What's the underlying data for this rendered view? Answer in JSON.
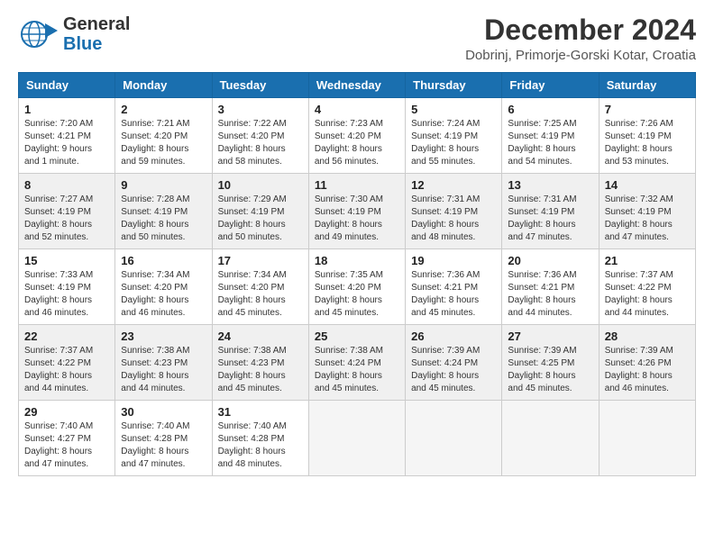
{
  "logo": {
    "line1": "General",
    "line2": "Blue"
  },
  "header": {
    "month": "December 2024",
    "location": "Dobrinj, Primorje-Gorski Kotar, Croatia"
  },
  "weekdays": [
    "Sunday",
    "Monday",
    "Tuesday",
    "Wednesday",
    "Thursday",
    "Friday",
    "Saturday"
  ],
  "weeks": [
    [
      {
        "day": "1",
        "sunrise": "Sunrise: 7:20 AM",
        "sunset": "Sunset: 4:21 PM",
        "daylight": "Daylight: 9 hours and 1 minute."
      },
      {
        "day": "2",
        "sunrise": "Sunrise: 7:21 AM",
        "sunset": "Sunset: 4:20 PM",
        "daylight": "Daylight: 8 hours and 59 minutes."
      },
      {
        "day": "3",
        "sunrise": "Sunrise: 7:22 AM",
        "sunset": "Sunset: 4:20 PM",
        "daylight": "Daylight: 8 hours and 58 minutes."
      },
      {
        "day": "4",
        "sunrise": "Sunrise: 7:23 AM",
        "sunset": "Sunset: 4:20 PM",
        "daylight": "Daylight: 8 hours and 56 minutes."
      },
      {
        "day": "5",
        "sunrise": "Sunrise: 7:24 AM",
        "sunset": "Sunset: 4:19 PM",
        "daylight": "Daylight: 8 hours and 55 minutes."
      },
      {
        "day": "6",
        "sunrise": "Sunrise: 7:25 AM",
        "sunset": "Sunset: 4:19 PM",
        "daylight": "Daylight: 8 hours and 54 minutes."
      },
      {
        "day": "7",
        "sunrise": "Sunrise: 7:26 AM",
        "sunset": "Sunset: 4:19 PM",
        "daylight": "Daylight: 8 hours and 53 minutes."
      }
    ],
    [
      {
        "day": "8",
        "sunrise": "Sunrise: 7:27 AM",
        "sunset": "Sunset: 4:19 PM",
        "daylight": "Daylight: 8 hours and 52 minutes."
      },
      {
        "day": "9",
        "sunrise": "Sunrise: 7:28 AM",
        "sunset": "Sunset: 4:19 PM",
        "daylight": "Daylight: 8 hours and 50 minutes."
      },
      {
        "day": "10",
        "sunrise": "Sunrise: 7:29 AM",
        "sunset": "Sunset: 4:19 PM",
        "daylight": "Daylight: 8 hours and 50 minutes."
      },
      {
        "day": "11",
        "sunrise": "Sunrise: 7:30 AM",
        "sunset": "Sunset: 4:19 PM",
        "daylight": "Daylight: 8 hours and 49 minutes."
      },
      {
        "day": "12",
        "sunrise": "Sunrise: 7:31 AM",
        "sunset": "Sunset: 4:19 PM",
        "daylight": "Daylight: 8 hours and 48 minutes."
      },
      {
        "day": "13",
        "sunrise": "Sunrise: 7:31 AM",
        "sunset": "Sunset: 4:19 PM",
        "daylight": "Daylight: 8 hours and 47 minutes."
      },
      {
        "day": "14",
        "sunrise": "Sunrise: 7:32 AM",
        "sunset": "Sunset: 4:19 PM",
        "daylight": "Daylight: 8 hours and 47 minutes."
      }
    ],
    [
      {
        "day": "15",
        "sunrise": "Sunrise: 7:33 AM",
        "sunset": "Sunset: 4:19 PM",
        "daylight": "Daylight: 8 hours and 46 minutes."
      },
      {
        "day": "16",
        "sunrise": "Sunrise: 7:34 AM",
        "sunset": "Sunset: 4:20 PM",
        "daylight": "Daylight: 8 hours and 46 minutes."
      },
      {
        "day": "17",
        "sunrise": "Sunrise: 7:34 AM",
        "sunset": "Sunset: 4:20 PM",
        "daylight": "Daylight: 8 hours and 45 minutes."
      },
      {
        "day": "18",
        "sunrise": "Sunrise: 7:35 AM",
        "sunset": "Sunset: 4:20 PM",
        "daylight": "Daylight: 8 hours and 45 minutes."
      },
      {
        "day": "19",
        "sunrise": "Sunrise: 7:36 AM",
        "sunset": "Sunset: 4:21 PM",
        "daylight": "Daylight: 8 hours and 45 minutes."
      },
      {
        "day": "20",
        "sunrise": "Sunrise: 7:36 AM",
        "sunset": "Sunset: 4:21 PM",
        "daylight": "Daylight: 8 hours and 44 minutes."
      },
      {
        "day": "21",
        "sunrise": "Sunrise: 7:37 AM",
        "sunset": "Sunset: 4:22 PM",
        "daylight": "Daylight: 8 hours and 44 minutes."
      }
    ],
    [
      {
        "day": "22",
        "sunrise": "Sunrise: 7:37 AM",
        "sunset": "Sunset: 4:22 PM",
        "daylight": "Daylight: 8 hours and 44 minutes."
      },
      {
        "day": "23",
        "sunrise": "Sunrise: 7:38 AM",
        "sunset": "Sunset: 4:23 PM",
        "daylight": "Daylight: 8 hours and 44 minutes."
      },
      {
        "day": "24",
        "sunrise": "Sunrise: 7:38 AM",
        "sunset": "Sunset: 4:23 PM",
        "daylight": "Daylight: 8 hours and 45 minutes."
      },
      {
        "day": "25",
        "sunrise": "Sunrise: 7:38 AM",
        "sunset": "Sunset: 4:24 PM",
        "daylight": "Daylight: 8 hours and 45 minutes."
      },
      {
        "day": "26",
        "sunrise": "Sunrise: 7:39 AM",
        "sunset": "Sunset: 4:24 PM",
        "daylight": "Daylight: 8 hours and 45 minutes."
      },
      {
        "day": "27",
        "sunrise": "Sunrise: 7:39 AM",
        "sunset": "Sunset: 4:25 PM",
        "daylight": "Daylight: 8 hours and 45 minutes."
      },
      {
        "day": "28",
        "sunrise": "Sunrise: 7:39 AM",
        "sunset": "Sunset: 4:26 PM",
        "daylight": "Daylight: 8 hours and 46 minutes."
      }
    ],
    [
      {
        "day": "29",
        "sunrise": "Sunrise: 7:40 AM",
        "sunset": "Sunset: 4:27 PM",
        "daylight": "Daylight: 8 hours and 47 minutes."
      },
      {
        "day": "30",
        "sunrise": "Sunrise: 7:40 AM",
        "sunset": "Sunset: 4:28 PM",
        "daylight": "Daylight: 8 hours and 47 minutes."
      },
      {
        "day": "31",
        "sunrise": "Sunrise: 7:40 AM",
        "sunset": "Sunset: 4:28 PM",
        "daylight": "Daylight: 8 hours and 48 minutes."
      },
      null,
      null,
      null,
      null
    ]
  ]
}
